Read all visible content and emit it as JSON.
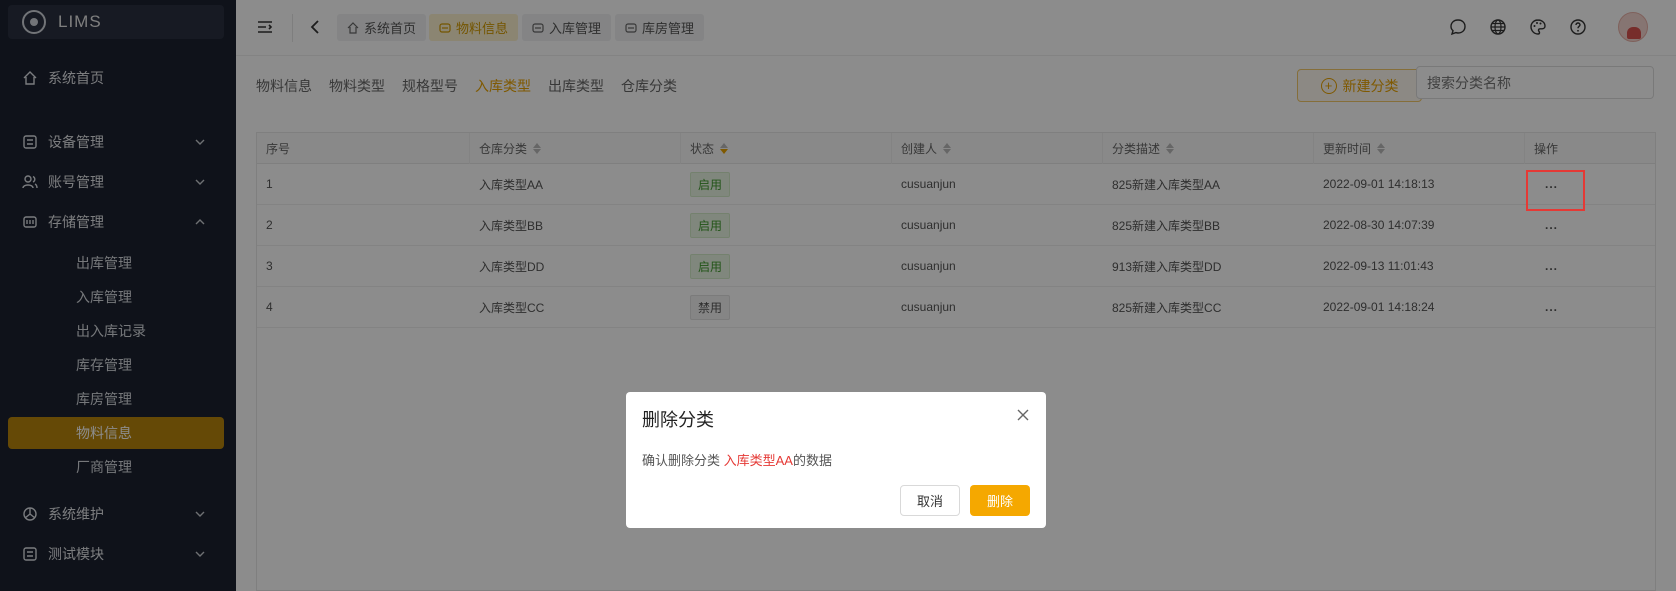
{
  "app": {
    "name": "LIMS"
  },
  "sidebar": {
    "items": [
      {
        "label": "系统首页",
        "icon": "home-icon"
      },
      {
        "label": "设备管理",
        "icon": "device-icon"
      },
      {
        "label": "账号管理",
        "icon": "users-icon"
      },
      {
        "label": "存储管理",
        "icon": "storage-icon"
      },
      {
        "label": "系统维护",
        "icon": "maintenance-icon"
      },
      {
        "label": "测试模块",
        "icon": "test-icon"
      }
    ],
    "sub_items": [
      "出库管理",
      "入库管理",
      "出入库记录",
      "库存管理",
      "库房管理",
      "物料信息",
      "厂商管理"
    ],
    "active_sub": "物料信息"
  },
  "header": {
    "tags": [
      {
        "label": "系统首页",
        "icon": "home-icon"
      },
      {
        "label": "物料信息",
        "icon": "material-icon",
        "active": true
      },
      {
        "label": "入库管理",
        "icon": "inbound-icon"
      },
      {
        "label": "库房管理",
        "icon": "warehouse-icon"
      }
    ]
  },
  "content": {
    "subtabs": [
      "物料信息",
      "物料类型",
      "规格型号",
      "入库类型",
      "出库类型",
      "仓库分类"
    ],
    "active_subtab": "入库类型",
    "new_button": "新建分类",
    "search_placeholder": "搜索分类名称"
  },
  "table": {
    "columns": [
      "序号",
      "仓库分类",
      "状态",
      "创建人",
      "分类描述",
      "更新时间",
      "操作"
    ],
    "rows": [
      {
        "index": "1",
        "category": "入库类型AA",
        "status": "启用",
        "creator": "cusuanjun",
        "desc": "825新建入库类型AA",
        "updated": "2022-09-01 14:18:13",
        "action": "..."
      },
      {
        "index": "2",
        "category": "入库类型BB",
        "status": "启用",
        "creator": "cusuanjun",
        "desc": "825新建入库类型BB",
        "updated": "2022-08-30 14:07:39",
        "action": "..."
      },
      {
        "index": "3",
        "category": "入库类型DD",
        "status": "启用",
        "creator": "cusuanjun",
        "desc": "913新建入库类型DD",
        "updated": "2022-09-13 11:01:43",
        "action": "..."
      },
      {
        "index": "4",
        "category": "入库类型CC",
        "status": "禁用",
        "creator": "cusuanjun",
        "desc": "825新建入库类型CC",
        "updated": "2022-09-01 14:18:24",
        "action": "..."
      }
    ]
  },
  "dialog": {
    "title": "删除分类",
    "message_prefix": "确认删除分类 ",
    "message_target": "入库类型AA",
    "message_suffix": "的数据",
    "cancel": "取消",
    "confirm": "删除"
  },
  "colors": {
    "accent": "#f5a800",
    "sidebar_bg": "#1c2230",
    "danger": "#e53935"
  }
}
